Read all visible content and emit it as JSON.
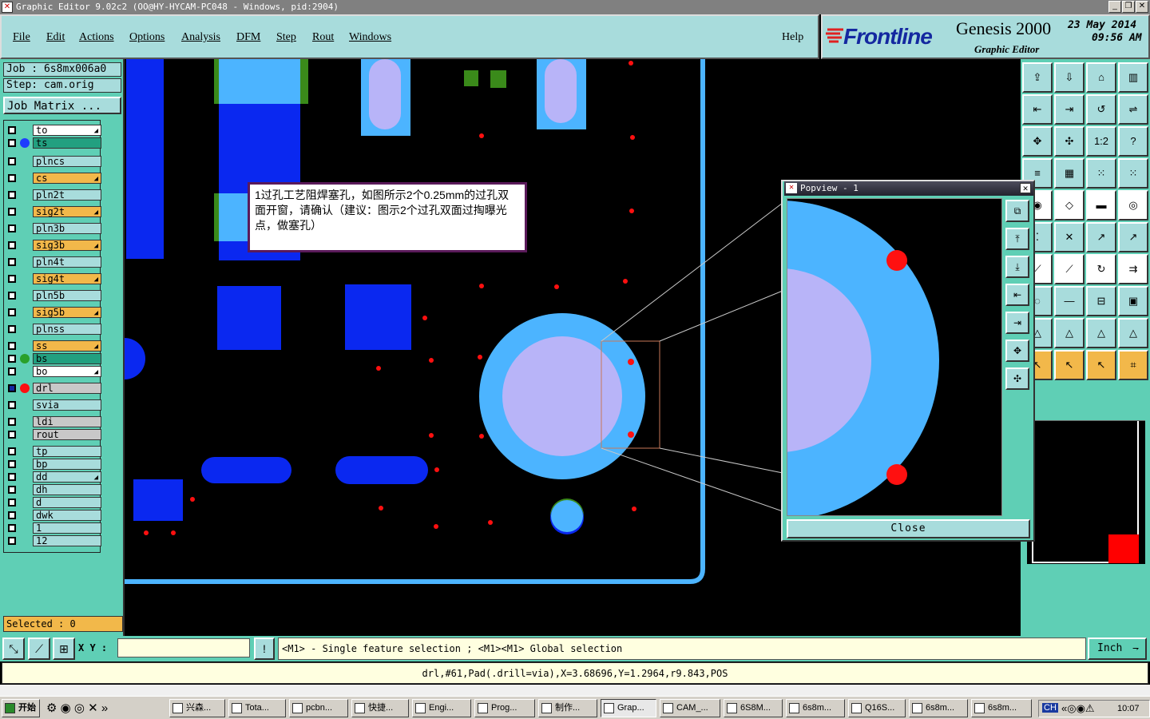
{
  "window": {
    "title": "Graphic Editor 9.02c2 (OO@HY-HYCAM-PC048 - Windows, pid:2904)"
  },
  "menu": {
    "items": [
      "File",
      "Edit",
      "Actions",
      "Options",
      "Analysis",
      "DFM",
      "Step",
      "Rout",
      "Windows"
    ],
    "help": "Help"
  },
  "brand": {
    "logo": "Frontline",
    "product": "Genesis 2000",
    "subtitle": "Graphic Editor",
    "date": "23 May 2014",
    "time": "09:56 AM"
  },
  "job": {
    "job_label": "Job : 6s8mx006a0",
    "step_label": "Step: cam.orig",
    "matrix_button": "Job Matrix ..."
  },
  "layers": [
    {
      "name": "to",
      "style": "wh",
      "dot": "",
      "tick": true
    },
    {
      "name": "ts",
      "style": "gr",
      "dot": "#1e3cff",
      "tick": false
    },
    {
      "name": "plncs",
      "style": "cy",
      "dot": "",
      "tick": false
    },
    {
      "name": "cs",
      "style": "tan",
      "dot": "",
      "tick": true
    },
    {
      "name": "pln2t",
      "style": "cy",
      "dot": "",
      "tick": false
    },
    {
      "name": "sig2t",
      "style": "tan",
      "dot": "",
      "tick": true
    },
    {
      "name": "pln3b",
      "style": "cy",
      "dot": "",
      "tick": false
    },
    {
      "name": "sig3b",
      "style": "tan",
      "dot": "",
      "tick": true
    },
    {
      "name": "pln4t",
      "style": "cy",
      "dot": "",
      "tick": false
    },
    {
      "name": "sig4t",
      "style": "tan",
      "dot": "",
      "tick": true
    },
    {
      "name": "pln5b",
      "style": "cy",
      "dot": "",
      "tick": false
    },
    {
      "name": "sig5b",
      "style": "tan",
      "dot": "",
      "tick": true
    },
    {
      "name": "plnss",
      "style": "cy",
      "dot": "",
      "tick": false
    },
    {
      "name": "ss",
      "style": "tan",
      "dot": "",
      "tick": true
    },
    {
      "name": "bs",
      "style": "gr",
      "dot": "#2aa02a",
      "tick": false
    },
    {
      "name": "bo",
      "style": "wh",
      "dot": "",
      "tick": true
    },
    {
      "name": "drl",
      "style": "gy",
      "dot": "#ff1010",
      "tick": false
    },
    {
      "name": "svia",
      "style": "cy",
      "dot": "",
      "tick": false
    },
    {
      "name": "ldi",
      "style": "gy",
      "dot": "",
      "tick": false
    },
    {
      "name": "rout",
      "style": "gy",
      "dot": "",
      "tick": false
    },
    {
      "name": "tp",
      "style": "cy",
      "dot": "",
      "tick": false
    },
    {
      "name": "bp",
      "style": "cy",
      "dot": "",
      "tick": false
    },
    {
      "name": "dd",
      "style": "cy",
      "dot": "",
      "tick": true
    },
    {
      "name": "dh",
      "style": "cy",
      "dot": "",
      "tick": false
    },
    {
      "name": "d",
      "style": "cy",
      "dot": "",
      "tick": false
    },
    {
      "name": "dwk",
      "style": "cy",
      "dot": "",
      "tick": false
    },
    {
      "name": "1",
      "style": "cy",
      "dot": "",
      "tick": false
    },
    {
      "name": "12",
      "style": "cy",
      "dot": "",
      "tick": false
    }
  ],
  "selected_label": "Selected : 0",
  "annotation": {
    "text": "1过孔工艺阻焊塞孔，如图所示2个0.25mm的过孔双面开窗，请确认（建议：图示2个过孔双面过掏曝光点，做塞孔）"
  },
  "popview": {
    "title": "Popview - 1",
    "close_label": "Close"
  },
  "cmdbar": {
    "xy_label": "X Y :",
    "xy_value": "",
    "hint": "<M1> - Single feature selection ; <M1><M1> Global selection",
    "unit": "Inch"
  },
  "infobar": {
    "text": "drl,#61,Pad(.drill=via),X=3.68696,Y=1.2964,r9.843,POS"
  },
  "taskbar": {
    "start": "开始",
    "tasks": [
      "兴森...",
      "Tota...",
      "pcbn...",
      "快捷...",
      "Engi...",
      "Prog...",
      "制作...",
      "Grap...",
      "CAM_...",
      "6S8M...",
      "6s8m...",
      "Q16S...",
      "6s8m...",
      "6s8m..."
    ],
    "lang": "CH",
    "clock": "10:07"
  },
  "colors": {
    "panel": "#5fcfb5",
    "button": "#a8dcdc",
    "pad_blue": "#0a28f0",
    "pad_light": "#4cb4ff",
    "pad_lavender": "#b8b4f8",
    "via_red": "#ff1010",
    "green": "#3a8a1a"
  }
}
